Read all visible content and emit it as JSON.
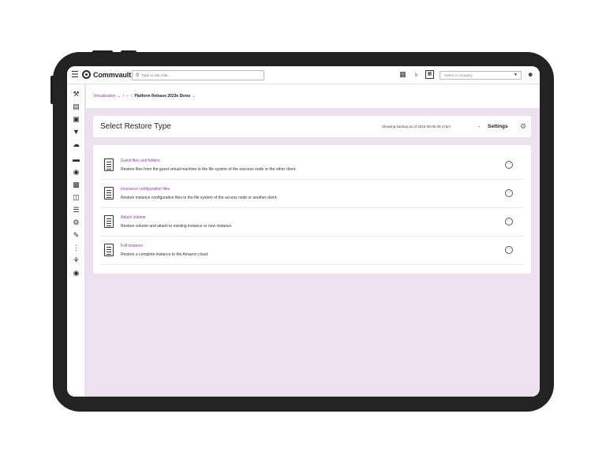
{
  "topbar": {
    "brand": "Commvault",
    "search_placeholder": "Type to ask Arlie...",
    "company_select": "Select a company"
  },
  "breadcrumb": {
    "root": "Virtualization",
    "sep1": "/",
    "middle": "–",
    "sep2": "/",
    "current": "Platform Release 2023e Demo"
  },
  "header": {
    "title": "Select Restore Type",
    "backup_label": "Showing backup as of 2023-08-05 09:17pm",
    "settings_label": "Settings"
  },
  "options": [
    {
      "title": "Guest files and folders",
      "description": "Restore files from the guest virtual machine to the file system of the eaccess node or the other client."
    },
    {
      "title": "Insurance configuration files",
      "description": "Restore instance configuration files to the file system of the access node or another client."
    },
    {
      "title": "Attach volume",
      "description": "Restore volume and attach to existing instance or new instance."
    },
    {
      "title": "Full instance",
      "description": "Restore a complete instance to the Amazon cloud."
    }
  ],
  "icons": {
    "menu": "hamburger-icon",
    "nav": [
      "tools-icon",
      "dashboard-icon",
      "storage-icon",
      "shield-icon",
      "cloud-icon",
      "briefcase-icon",
      "globe-icon",
      "monitor-icon",
      "database-icon",
      "sliders-icon",
      "gear-icon",
      "edit-icon",
      "apps-icon",
      "settings-icon",
      "commvault-icon"
    ]
  },
  "colors": {
    "accent": "#8a3fa0",
    "background": "#ede1f0"
  }
}
